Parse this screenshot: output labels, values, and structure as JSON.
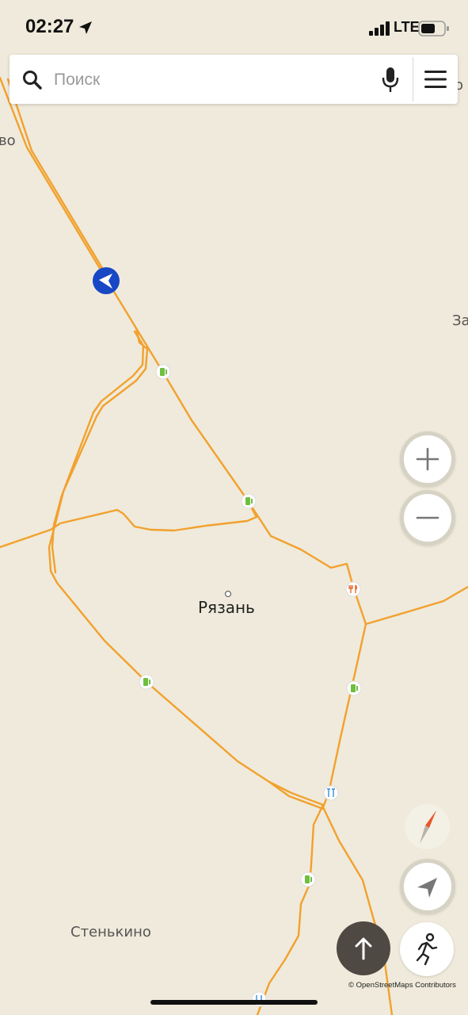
{
  "status_bar": {
    "time": "02:27",
    "network": "LTE",
    "icons": [
      "location-arrow-icon",
      "signal-bars-icon",
      "battery-icon"
    ]
  },
  "search": {
    "placeholder": "Поиск",
    "value": "",
    "icons": [
      "search-icon",
      "microphone-icon",
      "menu-icon"
    ]
  },
  "map": {
    "labels": {
      "city": "Рязань",
      "village": "Стенькино",
      "edge_left": "во",
      "edge_right": "За",
      "edge_right_top": "о"
    },
    "poi_icons": [
      "fuel-station-icon",
      "restaurant-icon",
      "car-service-icon"
    ],
    "colors": {
      "background": "#efeadb",
      "road": "#f2a12e",
      "user_location": "#1747c4",
      "fuel": "#6fbf3f",
      "restaurant": "#e4692f",
      "service": "#3a8fd6"
    }
  },
  "controls": {
    "zoom_in_icon": "plus-icon",
    "zoom_out_icon": "minus-icon",
    "compass_icon": "compass-icon",
    "locate_icon": "navigation-arrow-icon",
    "upload_icon": "arrow-up-icon",
    "walk_icon": "walking-person-icon"
  },
  "attribution": "© OpenStreetMaps Contributors"
}
